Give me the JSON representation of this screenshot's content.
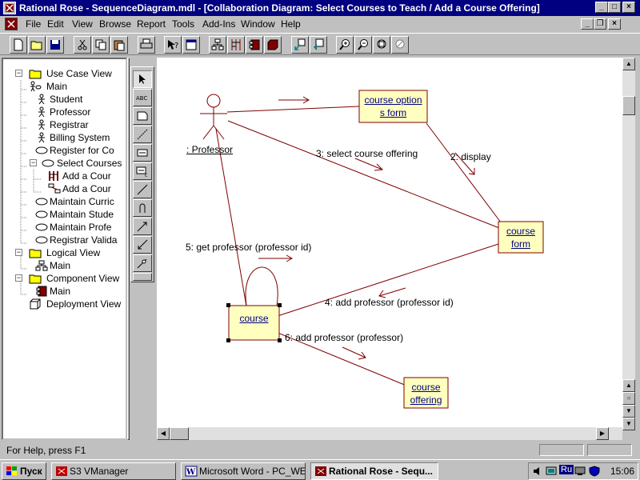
{
  "window": {
    "title": "Rational Rose - SequenceDiagram.mdl - [Collaboration Diagram: Select Courses to Teach / Add a Course Offering]"
  },
  "menu": [
    "File",
    "Edit",
    "View",
    "Browse",
    "Report",
    "Tools",
    "Add-Ins",
    "Window",
    "Help"
  ],
  "toolbar": {
    "buttons": [
      "new-icon",
      "open-icon",
      "save-icon",
      "cut-icon",
      "copy-icon",
      "paste-icon",
      "print-icon",
      "context-help-icon",
      "documentation-icon",
      "browse-class-icon",
      "browse-interaction-icon",
      "browse-component-icon",
      "browse-deployment-icon",
      "browse-parent-icon",
      "browse-previous-icon",
      "zoom-in-icon",
      "zoom-out-icon",
      "fit-in-window-icon",
      "undo-fit-icon"
    ]
  },
  "tree": {
    "use_case_view": "Use Case View",
    "uc_main": "Main",
    "student": "Student",
    "professor": "Professor",
    "registrar": "Registrar",
    "billing": "Billing System",
    "register_for": "Register for Co",
    "select_courses": "Select Courses",
    "add_course_1": "Add a Cour",
    "add_course_2": "Add a Cour",
    "maintain_curric": "Maintain Curric",
    "maintain_stude": "Maintain Stude",
    "maintain_profe": "Maintain Profe",
    "registrar_valid": "Registrar Valida",
    "logical_view": "Logical View",
    "lv_main": "Main",
    "component_view": "Component View",
    "cv_main": "Main",
    "deployment_view": "Deployment View"
  },
  "diagram": {
    "actor_label": ": Professor",
    "objects": {
      "course_option_form_l1": "course option",
      "course_option_form_l2": "s form",
      "course_form_l1": "course",
      "course_form_l2": "form",
      "course": "course",
      "course_offering_l1": "course",
      "course_offering_l2": "offering"
    },
    "messages": {
      "m2": "2: display",
      "m3": "3: select course offering",
      "m4": "4: add professor (professor id)",
      "m5": "5: get professor (professor id)",
      "m6": "6: add professor (professor)"
    },
    "colors": {
      "link": "#800000",
      "object_fill": "#ffffc0",
      "object_border": "#800000"
    }
  },
  "status": {
    "help": "For Help, press F1"
  },
  "taskbar": {
    "start": "Пуск",
    "items": [
      "S3 VManager",
      "Microsoft Word - PC_WEE...",
      "Rational Rose - Sequ..."
    ],
    "lang": "Ru",
    "clock": "15:06"
  }
}
